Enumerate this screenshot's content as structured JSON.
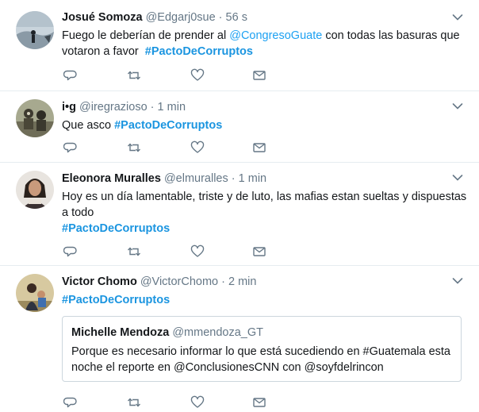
{
  "tweets": [
    {
      "name": "Josué Somoza",
      "handle": "@Edgarj0sue",
      "time": "56 s",
      "text_lines": [
        [
          {
            "t": "Fuego le deberían de prender al ",
            "k": "plain"
          },
          {
            "t": "@CongresoGuate",
            "k": "link"
          },
          {
            "t": " con todas las basuras que",
            "k": "plain"
          }
        ],
        [
          {
            "t": "votaron a favor  ",
            "k": "plain"
          },
          {
            "t": "#PactoDeCorruptos",
            "k": "tag"
          }
        ]
      ]
    },
    {
      "name": "i•g",
      "handle": "@iregrazioso",
      "time": "1 min",
      "text_lines": [
        [
          {
            "t": "Que asco ",
            "k": "plain"
          },
          {
            "t": "#PactoDeCorruptos",
            "k": "tag"
          }
        ]
      ]
    },
    {
      "name": "Eleonora Muralles",
      "handle": "@elmuralles",
      "time": "1 min",
      "text_lines": [
        [
          {
            "t": "Hoy es un día lamentable, triste y de luto, las mafias estan sueltas y dispuestas",
            "k": "plain"
          }
        ],
        [
          {
            "t": "a todo",
            "k": "plain"
          }
        ],
        [
          {
            "t": "#PactoDeCorruptos",
            "k": "tag"
          }
        ]
      ]
    },
    {
      "name": "Victor Chomo",
      "handle": "@VictorChomo",
      "time": "2 min",
      "text_lines": [
        [
          {
            "t": "#PactoDeCorruptos",
            "k": "tag"
          }
        ]
      ],
      "quote": {
        "name": "Michelle Mendoza",
        "handle": "@mmendoza_GT",
        "lines": [
          "Porque es necesario informar lo que está sucediendo en #Guatemala esta",
          "noche el reporte en @ConclusionesCNN con @soyfdelrincon"
        ]
      }
    }
  ],
  "separator": "·",
  "icons": [
    "reply-icon",
    "retweet-icon",
    "like-icon",
    "message-icon",
    "chevron-down-icon"
  ],
  "colors": {
    "link": "#1da1f2",
    "hashtag": "#1b95e0",
    "muted": "#657786",
    "icon": "#657786",
    "divider": "#e6ecf0"
  }
}
